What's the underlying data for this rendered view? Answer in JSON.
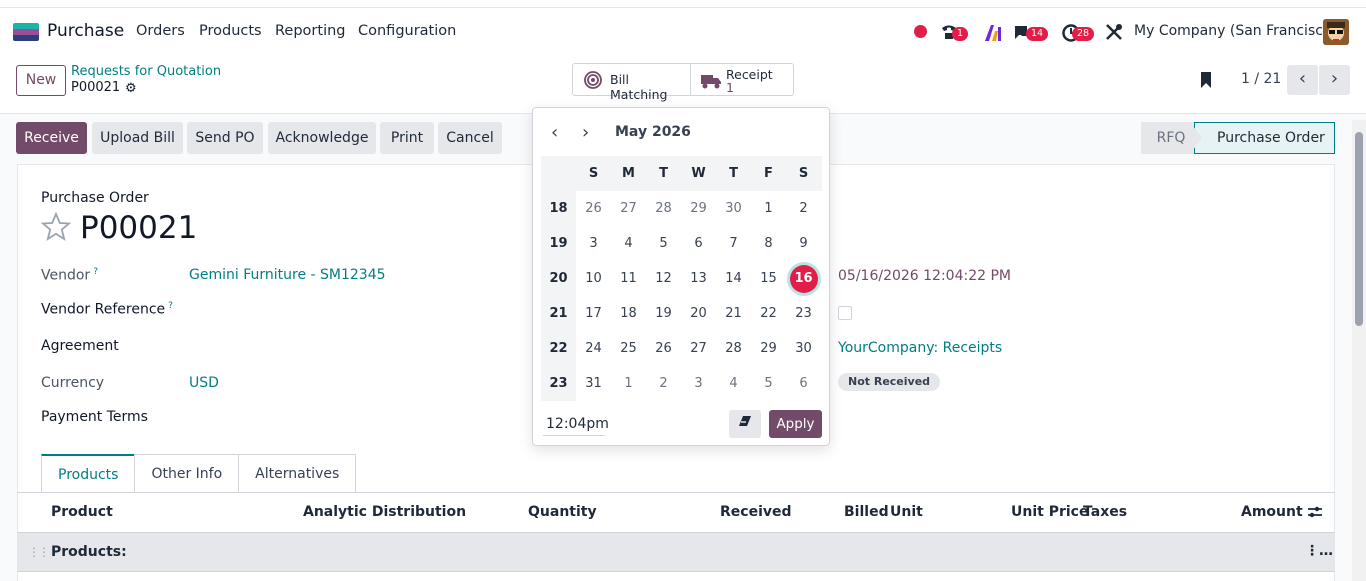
{
  "navbar": {
    "app_name": "Purchase",
    "menus": [
      "Orders",
      "Products",
      "Reporting",
      "Configuration"
    ],
    "badges": {
      "calls": "1",
      "messages": "14",
      "activities": "28"
    },
    "company": "My Company (San Francisco)"
  },
  "control_panel": {
    "new_label": "New",
    "breadcrumb_parent": "Requests for Quotation",
    "breadcrumb_current": "P00021",
    "smart_buttons": {
      "bill_matching": "Bill Matching",
      "receipt_label": "Receipt",
      "receipt_count": "1"
    },
    "pager": "1 / 21"
  },
  "actions": [
    "Receive",
    "Upload Bill",
    "Send PO",
    "Acknowledge",
    "Print",
    "Cancel"
  ],
  "statusbar": {
    "rfq": "RFQ",
    "purchase_order": "Purchase Order"
  },
  "form": {
    "subtitle": "Purchase Order",
    "title": "P00021",
    "vendor_label": "Vendor",
    "vendor_value": "Gemini Furniture - SM12345",
    "vendor_ref_label": "Vendor Reference",
    "agreement_label": "Agreement",
    "currency_label": "Currency",
    "currency_value": "USD",
    "payment_terms_label": "Payment Terms",
    "confirmation_date": "05/16/2026 12:04:22 PM",
    "deliver_to": "YourCompany: Receipts",
    "receipt_status": "Not Received"
  },
  "tabs": [
    "Products",
    "Other Info",
    "Alternatives"
  ],
  "table": {
    "columns": [
      "Product",
      "Analytic Distribution",
      "Quantity",
      "Received",
      "Billed",
      "Unit",
      "Unit Price",
      "Taxes",
      "Amount"
    ],
    "section": "Products:"
  },
  "datepicker": {
    "month": "May 2026",
    "weekdays": [
      "S",
      "M",
      "T",
      "W",
      "T",
      "F",
      "S"
    ],
    "weeks": [
      {
        "num": "18",
        "days": [
          "26",
          "27",
          "28",
          "29",
          "30",
          "1",
          "2"
        ]
      },
      {
        "num": "19",
        "days": [
          "3",
          "4",
          "5",
          "6",
          "7",
          "8",
          "9"
        ]
      },
      {
        "num": "20",
        "days": [
          "10",
          "11",
          "12",
          "13",
          "14",
          "15",
          "16"
        ]
      },
      {
        "num": "21",
        "days": [
          "17",
          "18",
          "19",
          "20",
          "21",
          "22",
          "23"
        ]
      },
      {
        "num": "22",
        "days": [
          "24",
          "25",
          "26",
          "27",
          "28",
          "29",
          "30"
        ]
      },
      {
        "num": "23",
        "days": [
          "31",
          "1",
          "2",
          "3",
          "4",
          "5",
          "6"
        ]
      }
    ],
    "selected": "16",
    "time": "12:04pm",
    "apply_label": "Apply"
  },
  "colors": {
    "brand": "#714b67",
    "link": "#017e84",
    "badge": "#e11d48"
  }
}
